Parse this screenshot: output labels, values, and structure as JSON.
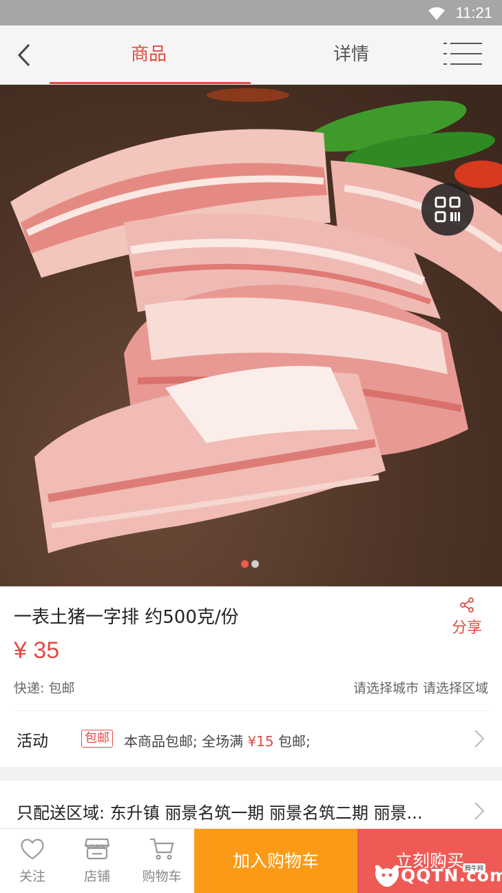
{
  "status_bar": {
    "time": "11:21",
    "wifi_icon": "wifi-icon"
  },
  "header": {
    "back_icon": "chevron-left-icon",
    "tabs": [
      {
        "label": "商品",
        "active": true
      },
      {
        "label": "详情",
        "active": false
      }
    ],
    "menu_icon": "menu-icon"
  },
  "gallery": {
    "qr_icon": "qr-code-icon",
    "total_images": 2,
    "current_index": 1
  },
  "product": {
    "title": "一表土猪一字排 约500克/份",
    "price": "¥ 35",
    "share_label": "分享",
    "express": "快递: 包邮",
    "city_select": "请选择城市 请选择区域"
  },
  "activity": {
    "label": "活动",
    "badge": "包邮",
    "text_before": "本商品包邮; 全场满 ",
    "amount": "¥15",
    "text_after": " 包邮;"
  },
  "delivery": {
    "text": "只配送区域: 东升镇 丽景名筑一期 丽景名筑二期 丽景..."
  },
  "bottom_bar": {
    "follow": "关注",
    "store": "店铺",
    "cart": "购物车",
    "add_to_cart": "加入购物车",
    "buy_now": "立刻购买"
  },
  "watermark": {
    "text": "QQTN.com",
    "sub": "腾牛网"
  },
  "colors": {
    "accent": "#e24b43",
    "orange": "#fb9a16",
    "buy_red": "#ef5a56"
  }
}
